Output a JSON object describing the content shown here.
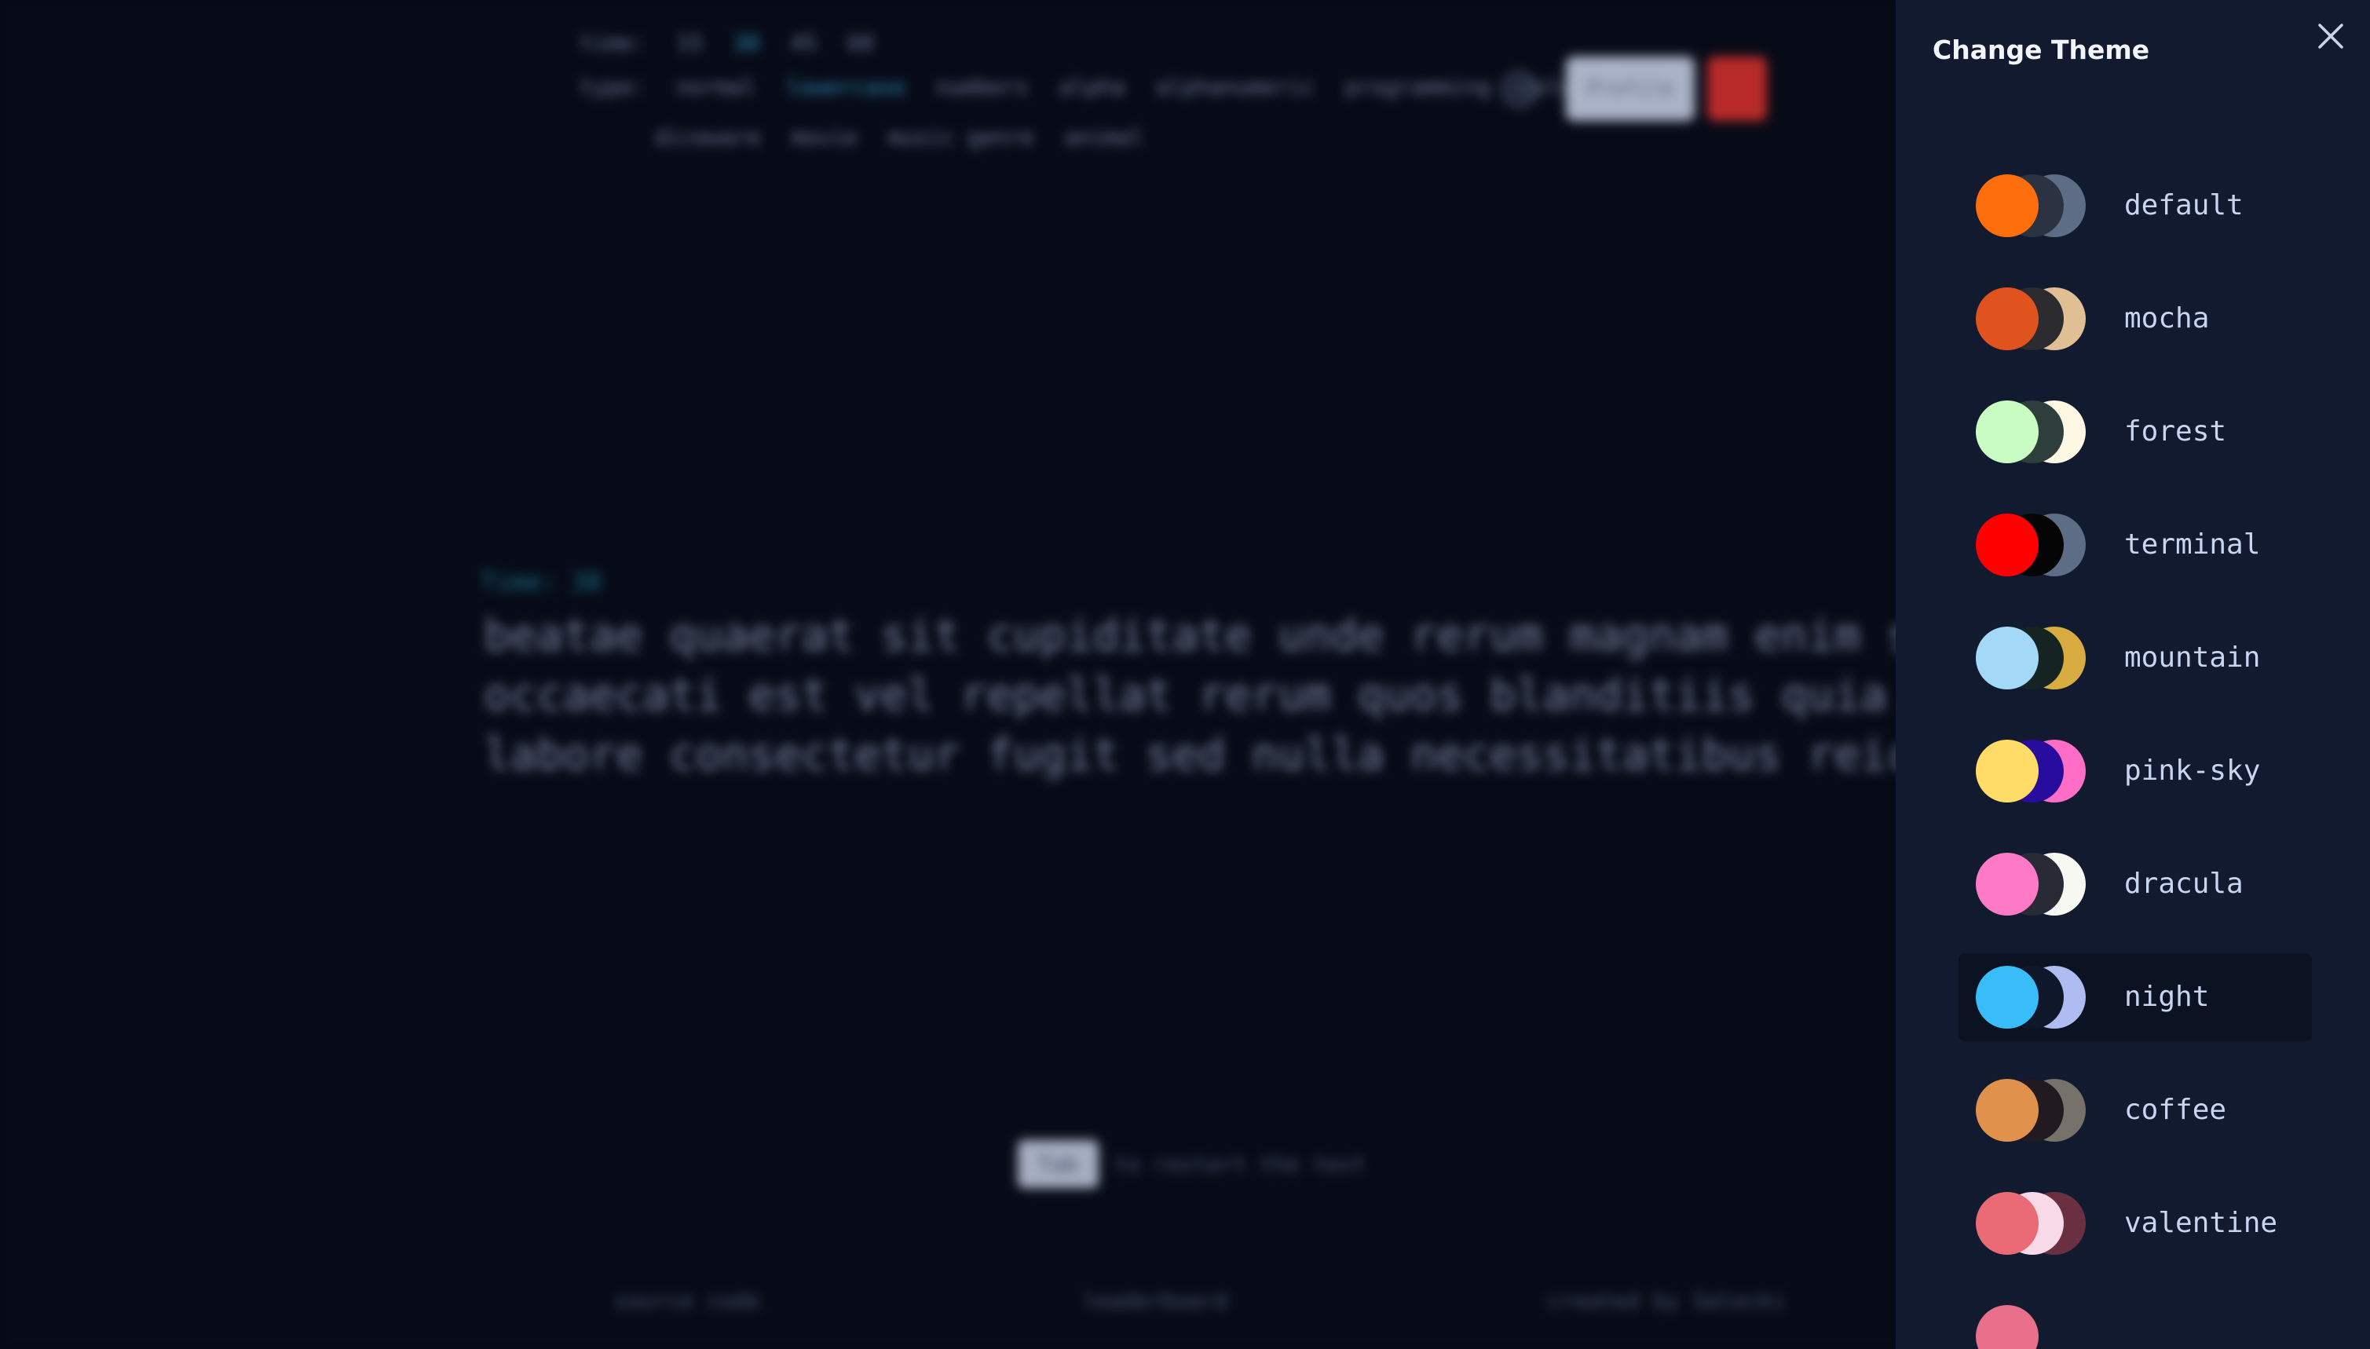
{
  "background_app": {
    "config": {
      "time_label": "time:",
      "time_options": [
        "15",
        "30",
        "45",
        "60"
      ],
      "time_active_index": 1,
      "type_label": "type:",
      "type_options": [
        "normal",
        "lowercase",
        "numbers",
        "alpha",
        "alphanumeric",
        "programming",
        "color"
      ],
      "type_active_index": 1,
      "type_options_row2": [
        "diceware",
        "movie",
        "music genre",
        "animal"
      ]
    },
    "profile_label": "Profile",
    "timer_label": "Time: 30",
    "typing_lines": [
      "beatae quaerat sit cupiditate unde rerum magnam enim sapiente",
      "occaecati est vel repellat rerum quos blanditiis quia sed esse",
      "labore consectetur fugit sed nulla necessitatibus reiciendis"
    ],
    "restart_key": "Tab",
    "restart_text": "to restart the test",
    "footer": {
      "source_code": "source code",
      "leaderboard": "leaderboard",
      "credit": "created by Salecki"
    }
  },
  "theme_panel": {
    "title": "Change Theme",
    "selected_theme": "night",
    "themes": [
      {
        "name": "default",
        "colors": [
          "#ff6e0d",
          "#2b3242",
          "#5d6d85"
        ]
      },
      {
        "name": "mocha",
        "colors": [
          "#e0531f",
          "#2c2b2f",
          "#e0bf95"
        ]
      },
      {
        "name": "forest",
        "colors": [
          "#c9fcc3",
          "#2d3e3c",
          "#fdf8e3"
        ]
      },
      {
        "name": "terminal",
        "colors": [
          "#fe0000",
          "#050505",
          "#5d6d85"
        ]
      },
      {
        "name": "mountain",
        "colors": [
          "#a4d8f7",
          "#152423",
          "#d8ac40"
        ]
      },
      {
        "name": "pink-sky",
        "colors": [
          "#ffdc67",
          "#280c9e",
          "#ff6dc6"
        ]
      },
      {
        "name": "dracula",
        "colors": [
          "#ff7ac6",
          "#282a36",
          "#f8f8f2"
        ]
      },
      {
        "name": "night",
        "colors": [
          "#38bdf8",
          "#0f172a",
          "#aebcf1"
        ]
      },
      {
        "name": "coffee",
        "colors": [
          "#e0924c",
          "#211a20",
          "#76726a"
        ]
      },
      {
        "name": "valentine",
        "colors": [
          "#ea6a75",
          "#f7d9e8",
          "#6a2f40"
        ]
      }
    ]
  }
}
